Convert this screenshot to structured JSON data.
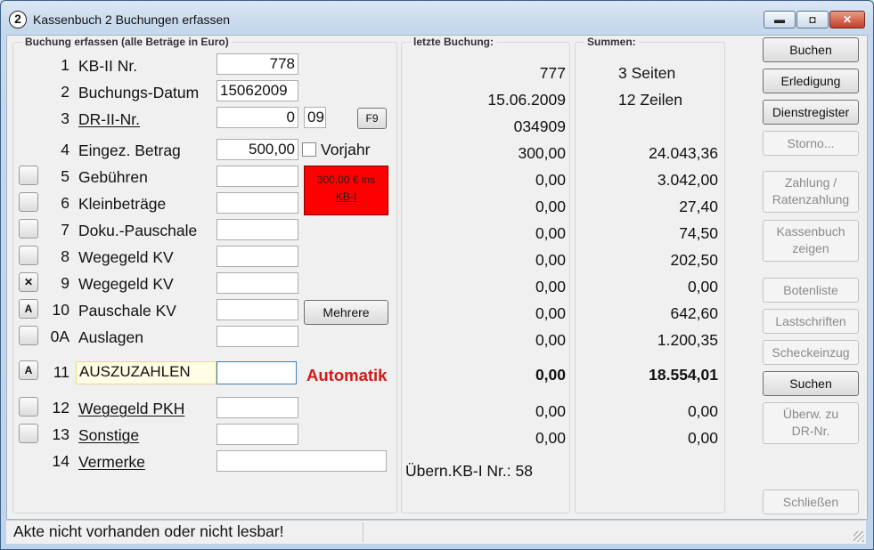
{
  "window": {
    "icon": "2",
    "title": "Kassenbuch 2 Buchungen erfassen",
    "min": "▬",
    "max": "◘",
    "close": "✕"
  },
  "left": {
    "title": "Buchung erfassen (alle Beträge in Euro)",
    "rows": [
      {
        "n": "1",
        "label": "KB-II Nr.",
        "value": "778"
      },
      {
        "n": "2",
        "label": "Buchungs-Datum",
        "value": "15062009"
      },
      {
        "n": "3",
        "label": "DR-II-Nr.",
        "value": "0",
        "value2": "09",
        "btn": "F9"
      },
      {
        "n": "4",
        "label": "Eingez. Betrag",
        "value": "500,00",
        "check": "Vorjahr"
      },
      {
        "n": "5",
        "label": "Gebühren",
        "value": ""
      },
      {
        "n": "6",
        "label": "Kleinbeträge",
        "value": ""
      },
      {
        "n": "7",
        "label": "Doku.-Pauschale",
        "value": ""
      },
      {
        "n": "8",
        "label": "Wegegeld KV",
        "value": ""
      },
      {
        "n": "9",
        "label": "Wegegeld KV",
        "value": "",
        "sq": "✕"
      },
      {
        "n": "10",
        "label": "Pauschale KV",
        "value": "",
        "sq": "A",
        "btn": "Mehrere"
      },
      {
        "n": "0A",
        "label": "Auslagen",
        "value": ""
      },
      {
        "n": "11",
        "label": "AUSZUZAHLEN",
        "value": "",
        "sq": "A"
      },
      {
        "n": "12",
        "label": "Wegegeld PKH",
        "value": ""
      },
      {
        "n": "13",
        "label": "Sonstige",
        "value": ""
      },
      {
        "n": "14",
        "label": "Vermerke",
        "value": ""
      }
    ],
    "red_box": [
      "300,00 € ins",
      "KB-I"
    ],
    "automatik": "Automatik"
  },
  "middle": {
    "title": "letzte Buchung:",
    "values": [
      "777",
      "15.06.2009",
      "034909",
      "300,00",
      "0,00",
      "0,00",
      "0,00",
      "0,00",
      "0,00",
      "0,00",
      "0,00",
      "0,00",
      "0,00",
      "0,00"
    ],
    "uebern": "Übern.KB-I Nr.: 58"
  },
  "right_sums": {
    "title": "Summen:",
    "pages": "3 Seiten",
    "lines": "12 Zeilen",
    "values": [
      "24.043,36",
      "3.042,00",
      "27,40",
      "74,50",
      "202,50",
      "0,00",
      "642,60",
      "1.200,35",
      "18.554,01",
      "0,00",
      "0,00"
    ]
  },
  "buttons": {
    "buchen": "Buchen",
    "erledigung": "Erledigung",
    "dienstregister": "Dienstregister",
    "storno": "Storno...",
    "zahlung_1": "Zahlung /",
    "zahlung_2": "Ratenzahlung",
    "kassenbuch_1": "Kassenbuch",
    "kassenbuch_2": "zeigen",
    "botenliste": "Botenliste",
    "lastschriften": "Lastschriften",
    "scheckeinzug": "Scheckeinzug",
    "suchen": "Suchen",
    "uberw_1": "Überw. zu",
    "uberw_2": "DR-Nr.",
    "schliessen": "Schließen"
  },
  "status": {
    "message": "Akte nicht vorhanden oder nicht lesbar!"
  }
}
